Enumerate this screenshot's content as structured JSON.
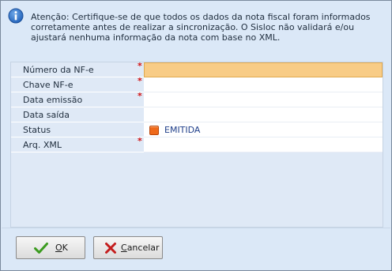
{
  "notice": {
    "icon": "info-icon",
    "text": "Atenção: Certifique-se de que todos os dados da nota fiscal foram informados corretamente antes de realizar a sincronização. O Sisloc não validará e/ou ajustará nenhuma informação da nota com base no XML."
  },
  "form": {
    "fields": [
      {
        "label": "Número da NF-e",
        "required": "*",
        "value": ""
      },
      {
        "label": "Chave NF-e",
        "required": "*",
        "value": ""
      },
      {
        "label": "Data emissão",
        "required": "*",
        "value": ""
      },
      {
        "label": "Data saída",
        "required": "",
        "value": ""
      },
      {
        "label": "Status",
        "required": "",
        "value": "EMITIDA"
      },
      {
        "label": "Arq. XML",
        "required": "*",
        "value": ""
      }
    ]
  },
  "buttons": {
    "ok": {
      "label": "OK",
      "icon": "check-icon"
    },
    "cancel": {
      "label": "Cancelar",
      "icon": "x-icon"
    }
  },
  "colors": {
    "required": "#d21010",
    "focused_field": "#f8cc86",
    "status_chip": "#ef6a1b",
    "ok_check": "#3b9b1f",
    "cancel_x": "#c41d1d"
  }
}
